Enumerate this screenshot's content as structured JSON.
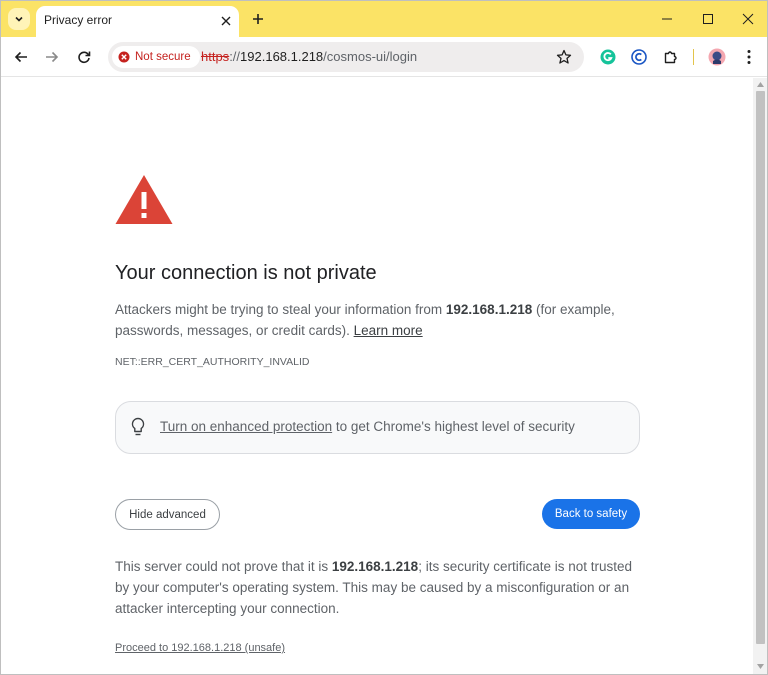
{
  "tab": {
    "title": "Privacy error"
  },
  "omnibox": {
    "security_chip": "Not secure",
    "url_scheme": "https",
    "url_sep": "://",
    "url_host": "192.168.1.218",
    "url_path": "/cosmos-ui/login"
  },
  "page": {
    "heading": "Your connection is not private",
    "intro_before": "Attackers might be trying to steal your information from ",
    "intro_host": "192.168.1.218",
    "intro_after": " (for example, passwords, messages, or credit cards). ",
    "learn_more": "Learn more",
    "error_code": "NET::ERR_CERT_AUTHORITY_INVALID",
    "enhanced_link": "Turn on enhanced protection",
    "enhanced_rest": " to get Chrome's highest level of security",
    "hide_advanced": "Hide advanced",
    "back_to_safety": "Back to safety",
    "details_before": "This server could not prove that it is ",
    "details_host": "192.168.1.218",
    "details_after": "; its security certificate is not trusted by your computer's operating system. This may be caused by a misconfiguration or an attacker intercepting your connection.",
    "proceed_link": "Proceed to 192.168.1.218 (unsafe)"
  },
  "colors": {
    "tabstrip": "#fbe366",
    "warning_red": "#db4437",
    "not_secure_red": "#c5221f",
    "primary_blue": "#1a73e8"
  },
  "icons": [
    "tab-search-icon",
    "close-icon",
    "plus-icon",
    "minimize-icon",
    "maximize-icon",
    "back-arrow-icon",
    "forward-arrow-icon",
    "reload-icon",
    "not-secure-icon",
    "star-icon",
    "grammarly-icon",
    "copyright-extension-icon",
    "puzzle-icon",
    "profile-avatar-icon",
    "kebab-menu-icon",
    "warning-triangle-icon",
    "lightbulb-icon"
  ]
}
